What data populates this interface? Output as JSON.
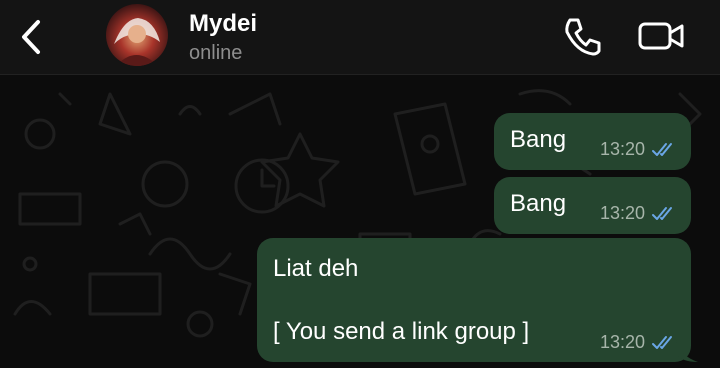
{
  "header": {
    "back_icon": "chevron-left-icon",
    "contact_name": "Mydei",
    "contact_status": "online",
    "call_icon": "phone-icon",
    "video_icon": "video-camera-icon"
  },
  "messages": [
    {
      "text": "Bang",
      "time": "13:20",
      "status": "read"
    },
    {
      "text": "Bang",
      "time": "13:20",
      "status": "read"
    },
    {
      "lines": [
        "Liat deh",
        "[ You send a link group ]"
      ],
      "time": "13:20",
      "status": "read"
    }
  ],
  "colors": {
    "header_bg": "#141414",
    "chat_bg": "#0c0c0c",
    "outgoing_bubble": "#25452f",
    "read_ticks": "#6aa6e6",
    "status_text": "#8e8e8e"
  }
}
